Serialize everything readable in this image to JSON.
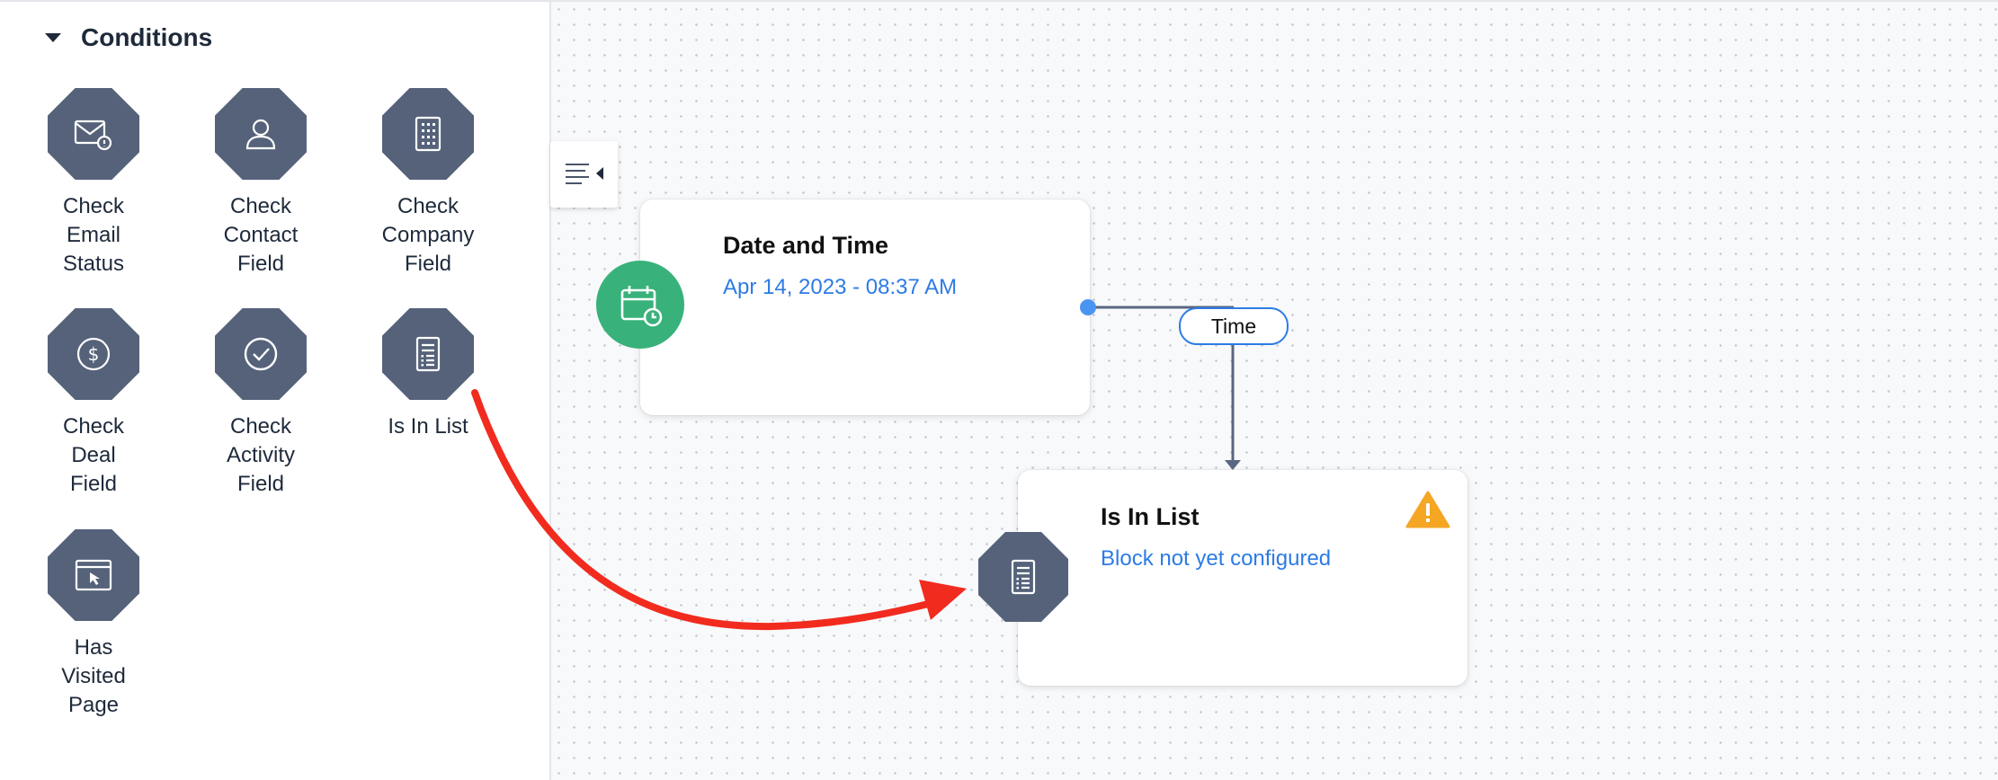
{
  "sidebar": {
    "section_title": "Conditions",
    "tools": [
      {
        "label": "Check\nEmail\nStatus",
        "icon": "email-status-icon"
      },
      {
        "label": "Check\nContact\nField",
        "icon": "contact-icon"
      },
      {
        "label": "Check\nCompany\nField",
        "icon": "company-building-icon"
      },
      {
        "label": "Check\nDeal\nField",
        "icon": "dollar-icon"
      },
      {
        "label": "Check\nActivity\nField",
        "icon": "check-circle-icon"
      },
      {
        "label": "Is In List",
        "icon": "list-document-icon"
      },
      {
        "label": "Has\nVisited\nPage",
        "icon": "browser-cursor-icon"
      }
    ]
  },
  "canvas": {
    "toggle_icon": "panel-collapse-icon",
    "date_node": {
      "title": "Date and Time",
      "subtitle": "Apr 14, 2023 - 08:37 AM",
      "icon": "calendar-clock-icon",
      "color": "#38b27a"
    },
    "connector_label": "Time",
    "list_node": {
      "title": "Is In List",
      "subtitle": "Block not yet configured",
      "icon": "list-document-icon",
      "warning_icon": "warning-triangle-icon",
      "warning_color": "#f5a623"
    }
  },
  "colors": {
    "accent": "#2d7be5",
    "node_slate": "#55627a",
    "annotation_arrow": "#f22b1f"
  }
}
